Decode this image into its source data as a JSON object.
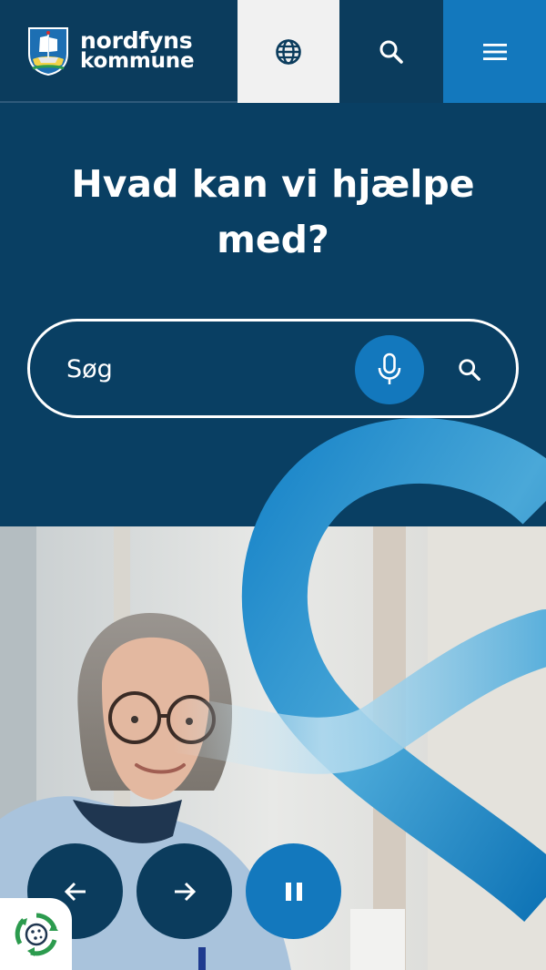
{
  "header": {
    "logo_line1": "nordfyns",
    "logo_line2": "kommune",
    "language_icon": "globe-icon",
    "search_icon": "search-icon",
    "menu_icon": "hamburger-menu-icon"
  },
  "hero": {
    "title": "Hvad kan vi hjælpe med?",
    "search": {
      "placeholder": "Søg",
      "mic_icon": "microphone-icon",
      "submit_icon": "search-icon"
    }
  },
  "carousel": {
    "image": "photo-woman-with-glasses",
    "prev_icon": "arrow-left-icon",
    "next_icon": "arrow-right-icon",
    "pause_icon": "pause-icon"
  },
  "cookie_icon": "cookie-consent-icon",
  "colors": {
    "navy": "#0b3c5d",
    "blue": "#1378bd",
    "white": "#ffffff",
    "light_gray": "#f1f1f1"
  }
}
